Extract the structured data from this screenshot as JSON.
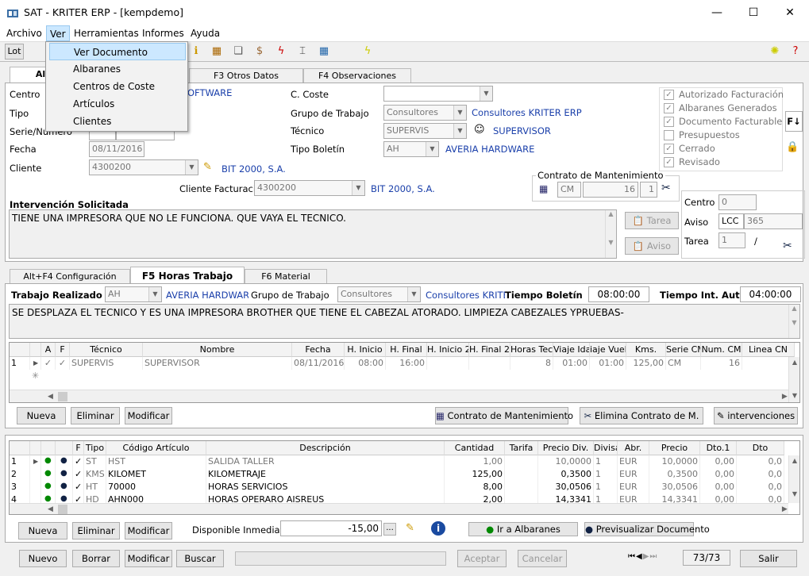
{
  "window": {
    "title": "SAT - KRITER ERP - [kempdemo]",
    "minimize": "—",
    "maximize": "☐",
    "close": "✕"
  },
  "menu": [
    "Archivo",
    "Ver",
    "Herramientas",
    "Informes",
    "Ayuda"
  ],
  "toolbar": {
    "lot": "Lot"
  },
  "dropdown": [
    "Ver Documento",
    "Albaranes",
    "Centros de Coste",
    "Artículos",
    "Clientes"
  ],
  "top_tabs": [
    "Alt+F",
    "F3 Otros Datos",
    "F4 Observaciones"
  ],
  "form": {
    "centro_label": "Centro",
    "centro_link": "OFTWARE",
    "tipo_label": "Tipo",
    "serie_label": "Serie/Número",
    "fecha_label": "Fecha",
    "fecha_value": "08/11/2016",
    "cliente_label": "Cliente",
    "cliente_value": "4300200",
    "cliente_link": "BIT 2000, S.A.",
    "cliente_fact_label": "Cliente Facturación",
    "cliente_fact_value": "4300200",
    "cliente_fact_link": "BIT 2000, S.A.",
    "ccoste_label": "C. Coste",
    "grupo_label": "Grupo de Trabajo",
    "grupo_value": "Consultores",
    "grupo_link": "Consultores KRITER ERP",
    "tecnico_label": "Técnico",
    "tecnico_value": "SUPERVIS",
    "tecnico_link": "SUPERVISOR",
    "boletin_label": "Tipo Boletín",
    "boletin_value": "AH",
    "boletin_link": "AVERIA HARDWARE",
    "contrato_label": "Contrato de Mantenimiento",
    "contrato_cm": "CM",
    "contrato_num": "16",
    "contrato_n": "1",
    "interv_label": "Intervención Solicitada",
    "interv_text": "TIENE UNA IMPRESORA QUE NO LE FUNCIONA. QUE VAYA EL TECNICO.",
    "tarea_btn": "Tarea",
    "aviso_btn": "Aviso",
    "centro2_label": "Centro",
    "centro2_value": "0",
    "aviso_label": "Aviso",
    "aviso_value1": "LCC",
    "aviso_value2": "365",
    "tarea_label": "Tarea",
    "tarea_value": "1",
    "tarea_slash": "/"
  },
  "checks": [
    {
      "label": "Autorizado Facturación",
      "checked": true
    },
    {
      "label": "Albaranes Generados",
      "checked": true
    },
    {
      "label": "Documento Facturable",
      "checked": true
    },
    {
      "label": "Presupuestos",
      "checked": false
    },
    {
      "label": "Cerrado",
      "checked": true
    },
    {
      "label": "Revisado",
      "checked": true
    }
  ],
  "side_f": "F↓",
  "mid_tabs": [
    "Alt+F4 Configuración",
    "F5 Horas Trabajo",
    "F6 Material"
  ],
  "horas": {
    "trabajo_label": "Trabajo Realizado",
    "trabajo_value": "AH",
    "trabajo_link": "AVERIA HARDWARE",
    "grupo_label": "Grupo de Trabajo",
    "grupo_value": "Consultores",
    "grupo_link": "Consultores KRITER",
    "tiempo_label": "Tiempo Boletín",
    "tiempo_value": "08:00:00",
    "tint_label": "Tiempo Int. Aut.",
    "tint_value": "04:00:00",
    "desc": "SE DESPLAZA EL TECNICO Y ES UNA IMPRESORA BROTHER QUE TIENE EL CABEZAL ATORADO. LIMPIEZA CABEZALES YPRUEBAS-"
  },
  "grid1": {
    "headers": [
      "",
      "",
      "A",
      "F",
      "Técnico",
      "Nombre",
      "Fecha",
      "H. Inicio",
      "H. Final",
      "H. Inicio 2",
      "H. Final 2",
      "Horas Tec.",
      "Viaje Ida",
      "iaje Vuelt",
      "Kms.",
      "Serie CM",
      "Num. CM",
      "Linea CN"
    ],
    "row": [
      "1",
      "",
      "✓",
      "✓",
      "SUPERVIS",
      "SUPERVISOR",
      "08/11/2016",
      "08:00",
      "16:00",
      "",
      "",
      "8",
      "01:00",
      "01:00",
      "125,00",
      "CM",
      "16",
      ""
    ],
    "newrow": "✳"
  },
  "btns1": {
    "nueva": "Nueva",
    "eliminar": "Eliminar",
    "modificar": "Modificar",
    "contrato": "Contrato de Mantenimiento",
    "elimina_contrato": "Elimina Contrato de M.",
    "intervenciones": "intervenciones"
  },
  "grid2": {
    "headers": [
      "",
      "",
      "",
      "",
      "F",
      "Tipo",
      "Código Artículo",
      "Descripción",
      "Cantidad",
      "Tarifa",
      "Precio Div.",
      "Divisa",
      "Abr.",
      "Precio",
      "Dto.1",
      "Dto"
    ],
    "rows": [
      [
        "1",
        "",
        "",
        "",
        "✓",
        "ST",
        "HST",
        "SALIDA TALLER",
        "1,00",
        "",
        "10,0000",
        "1",
        "EUR",
        "10,0000",
        "0,00",
        "0,0"
      ],
      [
        "2",
        "",
        "",
        "",
        "✓",
        "KMS",
        "KILOMET",
        "KILOMETRAJE",
        "125,00",
        "",
        "0,3500",
        "1",
        "EUR",
        "0,3500",
        "0,00",
        "0,0"
      ],
      [
        "3",
        "",
        "",
        "",
        "✓",
        "HT",
        "70000",
        "HORAS SERVICIOS",
        "8,00",
        "",
        "30,0506",
        "1",
        "EUR",
        "30,0506",
        "0,00",
        "0,0"
      ],
      [
        "4",
        "",
        "",
        "",
        "✓",
        "HD",
        "AHN000",
        "HORAS OPERARO AISREUS",
        "2,00",
        "",
        "14,3341",
        "1",
        "EUR",
        "14,3341",
        "0,00",
        "0,0"
      ]
    ]
  },
  "btns2": {
    "nueva": "Nueva",
    "eliminar": "Eliminar",
    "modificar": "Modificar",
    "disponible_label": "Disponible Inmediato",
    "disponible_value": "-15,00",
    "dots": "...",
    "ir_albaranes": "Ir a Albaranes",
    "previsualizar": "Previsualizar Documento"
  },
  "bottom": {
    "nuevo": "Nuevo",
    "borrar": "Borrar",
    "modificar": "Modificar",
    "buscar": "Buscar",
    "aceptar": "Aceptar",
    "cancelar": "Cancelar",
    "record": "73/73",
    "salir": "Salir"
  }
}
